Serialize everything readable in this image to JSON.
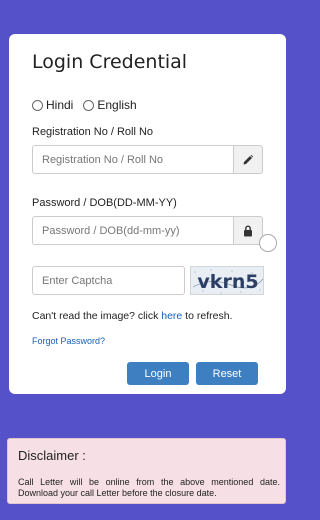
{
  "login": {
    "title": "Login Credential",
    "languages": [
      "Hindi",
      "English"
    ],
    "registration": {
      "label": "Registration No / Roll No",
      "placeholder": "Registration No / Roll No"
    },
    "password": {
      "label": "Password / DOB(DD-MM-YY)",
      "placeholder": "Password / DOB(dd-mm-yy)"
    },
    "captcha": {
      "placeholder": "Enter Captcha",
      "image_text": "vkrn5"
    },
    "refresh": {
      "prefix": "Can't read the image? click ",
      "link": "here",
      "suffix": " to refresh."
    },
    "forgot_password": "Forgot Password?",
    "buttons": {
      "login": "Login",
      "reset": "Reset"
    },
    "accent_color": "#3d7fc1"
  },
  "disclaimer": {
    "title": "Disclaimer :",
    "text": "Call Letter will be online from the above mentioned date. Download your call Letter before the closure date."
  },
  "theme": {
    "background": "#5551c8",
    "disclaimer_bg": "#f6e0e5"
  },
  "icons": {
    "registration_addon": "pencil-icon",
    "password_addon": "lock-icon"
  }
}
